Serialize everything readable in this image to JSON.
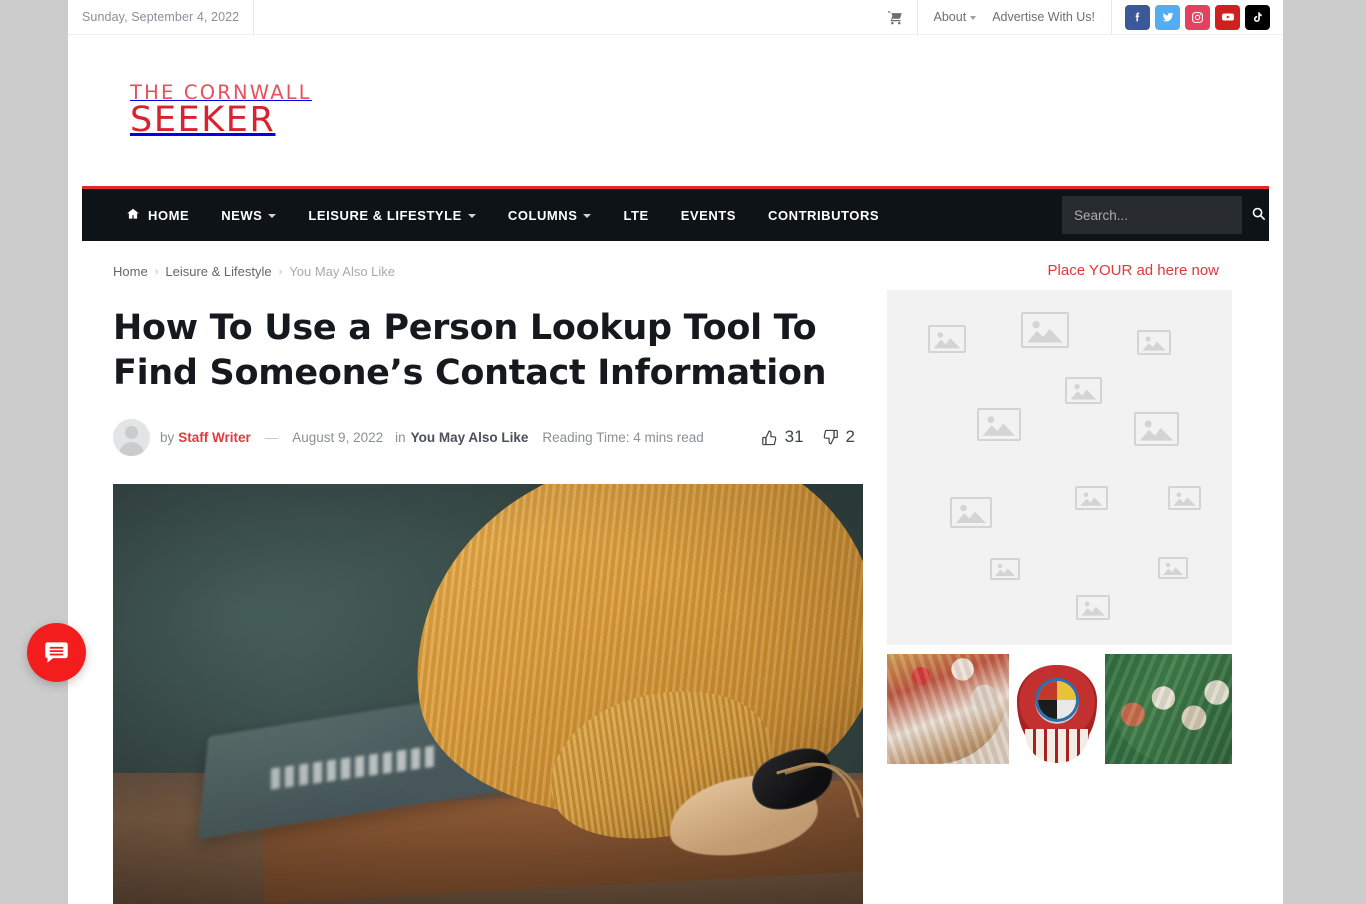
{
  "topbar": {
    "date": "Sunday, September 4, 2022",
    "cart_icon": "shopping-cart-icon",
    "links": [
      {
        "label": "About",
        "has_caret": true
      },
      {
        "label": "Advertise With Us!",
        "has_caret": false
      }
    ],
    "socials": [
      {
        "name": "facebook",
        "glyph": "f",
        "color": "#3b5998"
      },
      {
        "name": "twitter",
        "glyph": "t",
        "color": "#55acee"
      },
      {
        "name": "instagram",
        "glyph": "i",
        "color": "#e4405f"
      },
      {
        "name": "youtube",
        "glyph": "y",
        "color": "#cd201f"
      },
      {
        "name": "tiktok",
        "glyph": "d",
        "color": "#000000"
      }
    ]
  },
  "logo": {
    "line1": "THE CORNWALL",
    "line2": "SEEKER",
    "color1": "#e8505b",
    "color2": "#d8232f"
  },
  "nav": {
    "accent_color": "#e02b29",
    "background": "#0e1317",
    "items": [
      {
        "label": "HOME",
        "icon": "home-icon",
        "caret": false
      },
      {
        "label": "NEWS",
        "icon": null,
        "caret": true
      },
      {
        "label": "LEISURE & LIFESTYLE",
        "icon": null,
        "caret": true
      },
      {
        "label": "COLUMNS",
        "icon": null,
        "caret": true
      },
      {
        "label": "LTE",
        "icon": null,
        "caret": false
      },
      {
        "label": "EVENTS",
        "icon": null,
        "caret": false
      },
      {
        "label": "CONTRIBUTORS",
        "icon": null,
        "caret": false
      }
    ],
    "search": {
      "placeholder": "Search...",
      "value": "",
      "icon": "search-icon"
    }
  },
  "breadcrumb": {
    "items": [
      "Home",
      "Leisure & Lifestyle",
      "You May Also Like"
    ],
    "separator": "›"
  },
  "article": {
    "title": "How To Use a Person Lookup Tool To Find Someone’s Contact Information",
    "by_label": "by",
    "author": "Staff Writer",
    "dash": "—",
    "date": "August 9, 2022",
    "in_label": "in",
    "category": "You May Also Like",
    "reading_time": "Reading Time: 4 mins read",
    "avatar": "default-avatar",
    "reactions": {
      "likes": "31",
      "dislikes": "2",
      "like_icon": "thumbs-up-icon",
      "dislike_icon": "thumbs-down-icon"
    },
    "featured_image_alt": "Person in mustard knit sweater typing on a laptop at a wooden desk"
  },
  "sidebar": {
    "ad_label": "Place YOUR ad here now",
    "ad_label_color": "#e0383c",
    "ad_placeholder_count": 13,
    "ad_banner_alt": "Powwow dancers in regalia and a beaded medicine-wheel turtle emblem"
  },
  "chat": {
    "icon": "chat-bubble-icon",
    "color": "#f41d1d"
  }
}
